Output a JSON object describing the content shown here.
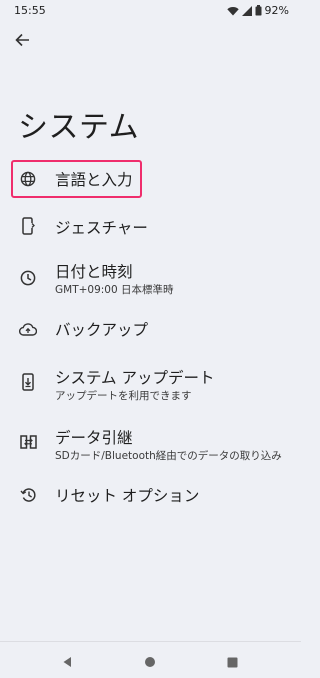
{
  "status_bar": {
    "time": "15:55",
    "battery": "92%",
    "icons": [
      "wifi-icon",
      "signal-icon",
      "battery-icon"
    ]
  },
  "header": {
    "back_icon": "arrow-left-icon",
    "title": "システム"
  },
  "menu": [
    {
      "label": "言語と入力",
      "icon": "globe-icon",
      "highlighted": true
    },
    {
      "label": "ジェスチャー",
      "icon": "phone-gesture-icon"
    },
    {
      "label": "日付と時刻",
      "sublabel": "GMT+09:00 日本標準時",
      "icon": "clock-icon"
    },
    {
      "label": "バックアップ",
      "icon": "cloud-upload-icon"
    },
    {
      "label": "システム アップデート",
      "sublabel": "アップデートを利用できます",
      "icon": "system-update-icon"
    },
    {
      "label": "データ引継",
      "sublabel": "SDカード/Bluetooth経由でのデータの取り込み",
      "icon": "data-transfer-icon"
    },
    {
      "label": "リセット オプション",
      "icon": "history-icon"
    }
  ],
  "colors": {
    "background": "#eef0f5",
    "highlight": "#ef2d6c",
    "text": "#1f1f1f"
  },
  "nav_bar": {
    "icons": [
      "back-triangle-icon",
      "home-circle-icon",
      "recents-square-icon"
    ]
  }
}
